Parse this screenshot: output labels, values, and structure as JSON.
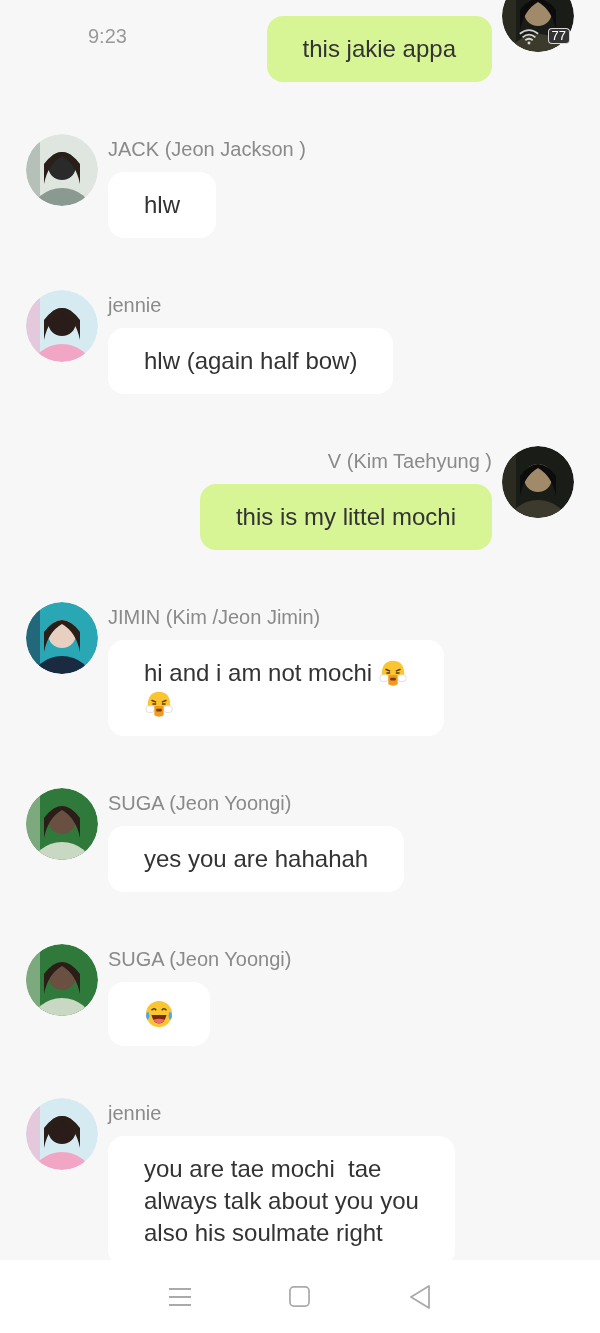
{
  "status_bar": {
    "time": "9:23",
    "battery": "77"
  },
  "messages": [
    {
      "kind": "outgoing",
      "lines": [
        {
          "text": "this jakie appa"
        }
      ]
    },
    {
      "kind": "incoming",
      "sender": "JACK (Jeon Jackson )",
      "lines": [
        {
          "text": "hlw"
        }
      ]
    },
    {
      "kind": "incoming",
      "sender": "jennie",
      "lines": [
        {
          "text": "hlw (again half bow)"
        }
      ]
    },
    {
      "kind": "outgoing",
      "sender": "V (Kim Taehyung )",
      "lines": [
        {
          "text": "this is my littel mochi"
        }
      ]
    },
    {
      "kind": "incoming",
      "sender": "JIMIN (Kim /Jeon Jimin)",
      "lines": [
        {
          "text": "hi and i am not mochi",
          "emojis": [
            {
              "kind": "huff"
            }
          ]
        },
        {
          "emojis": [
            {
              "kind": "huff"
            }
          ]
        }
      ]
    },
    {
      "kind": "incoming",
      "sender": "SUGA (Jeon Yoongi)",
      "lines": [
        {
          "text": "yes you are hahahah"
        }
      ]
    },
    {
      "kind": "incoming",
      "sender": "SUGA (Jeon Yoongi)",
      "lines": [
        {
          "emojis": [
            {
              "kind": "laugh"
            }
          ]
        }
      ]
    },
    {
      "kind": "incoming",
      "sender": "jennie",
      "lines": [
        {
          "text": "you are tae mochi  tae"
        },
        {
          "text": "always talk about you you"
        },
        {
          "text": "also his soulmate right"
        }
      ]
    }
  ],
  "nav_bar": {
    "buttons": [
      {
        "kind": "menu"
      },
      {
        "kind": "home"
      },
      {
        "kind": "back"
      }
    ]
  }
}
